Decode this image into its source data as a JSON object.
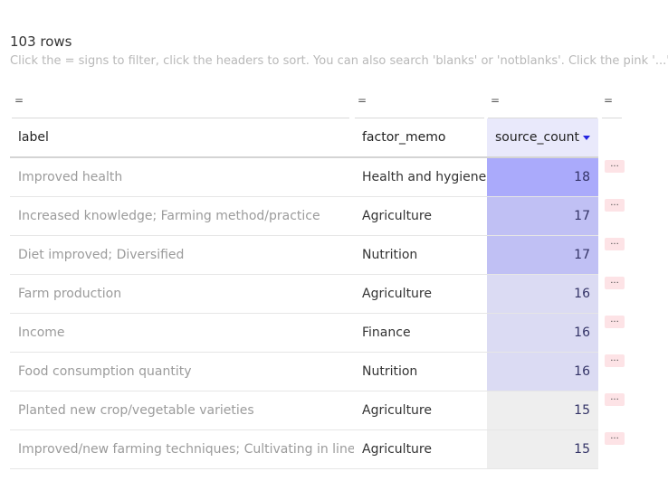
{
  "summary": {
    "row_count": "103 rows",
    "hint": "Click the = signs to filter, click the headers to sort. You can also search 'blanks' or 'notblanks'. Click the pink '...' to e"
  },
  "filter_symbol": "=",
  "columns": [
    "label",
    "factor_memo",
    "source_count"
  ],
  "sorted_column": "source_count",
  "row_action_label": "...",
  "rows": [
    {
      "label": "Improved health",
      "factor_memo": "Health and hygiene",
      "source_count": 18,
      "shade": "#aaaafb"
    },
    {
      "label": "Increased knowledge; Farming method/practice",
      "factor_memo": "Agriculture",
      "source_count": 17,
      "shade": "#c0c0f4"
    },
    {
      "label": "Diet improved; Diversified",
      "factor_memo": "Nutrition",
      "source_count": 17,
      "shade": "#c0c0f4"
    },
    {
      "label": "Farm production",
      "factor_memo": "Agriculture",
      "source_count": 16,
      "shade": "#dbdbf3"
    },
    {
      "label": "Income",
      "factor_memo": "Finance",
      "source_count": 16,
      "shade": "#dbdbf3"
    },
    {
      "label": "Food consumption quantity",
      "factor_memo": "Nutrition",
      "source_count": 16,
      "shade": "#dbdbf3"
    },
    {
      "label": "Planted new crop/vegetable varieties",
      "factor_memo": "Agriculture",
      "source_count": 15,
      "shade": "#eeeeee"
    },
    {
      "label": "Improved/new farming techniques; Cultivating in lines",
      "factor_memo": "Agriculture",
      "source_count": 15,
      "shade": "#eeeeee"
    }
  ]
}
